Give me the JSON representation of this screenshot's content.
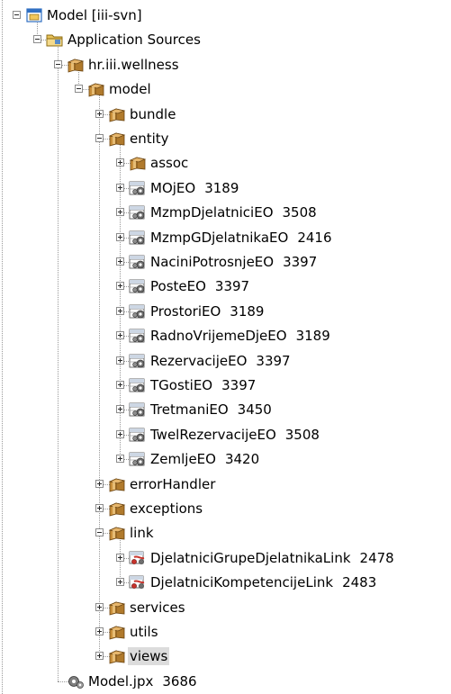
{
  "tree": {
    "items": [
      {
        "label": "Model [iii-svn]",
        "icon": "project-icon",
        "expanded": true,
        "depth": 0
      },
      {
        "label": "Application Sources",
        "icon": "folder-icon",
        "expanded": true,
        "depth": 1
      },
      {
        "label": "hr.iii.wellness",
        "icon": "package-icon",
        "expanded": true,
        "depth": 2
      },
      {
        "label": "model",
        "icon": "package-icon",
        "expanded": true,
        "depth": 3
      },
      {
        "label": "bundle",
        "icon": "package-icon",
        "expanded": false,
        "depth": 4
      },
      {
        "label": "entity",
        "icon": "package-icon",
        "expanded": true,
        "depth": 4
      },
      {
        "label": "assoc",
        "icon": "package-icon",
        "expanded": false,
        "depth": 5
      },
      {
        "label": "MOjEO",
        "version": "3189",
        "icon": "entity-object-icon",
        "expanded": false,
        "depth": 5
      },
      {
        "label": "MzmpDjelatniciEO",
        "version": "3508",
        "icon": "entity-object-icon",
        "expanded": false,
        "depth": 5
      },
      {
        "label": "MzmpGDjelatnikaEO",
        "version": "2416",
        "icon": "entity-object-icon",
        "expanded": false,
        "depth": 5
      },
      {
        "label": "NaciniPotrosnjeEO",
        "version": "3397",
        "icon": "entity-object-icon",
        "expanded": false,
        "depth": 5
      },
      {
        "label": "PosteEO",
        "version": "3397",
        "icon": "entity-object-icon",
        "expanded": false,
        "depth": 5
      },
      {
        "label": "ProstoriEO",
        "version": "3189",
        "icon": "entity-object-icon",
        "expanded": false,
        "depth": 5
      },
      {
        "label": "RadnoVrijemeDjeEO",
        "version": "3189",
        "icon": "entity-object-icon",
        "expanded": false,
        "depth": 5
      },
      {
        "label": "RezervacijeEO",
        "version": "3397",
        "icon": "entity-object-icon",
        "expanded": false,
        "depth": 5
      },
      {
        "label": "TGostiEO",
        "version": "3397",
        "icon": "entity-object-icon",
        "expanded": false,
        "depth": 5
      },
      {
        "label": "TretmaniEO",
        "version": "3450",
        "icon": "entity-object-icon",
        "expanded": false,
        "depth": 5
      },
      {
        "label": "TwelRezervacijeEO",
        "version": "3508",
        "icon": "entity-object-icon",
        "expanded": false,
        "depth": 5
      },
      {
        "label": "ZemljeEO",
        "version": "3420",
        "icon": "entity-object-icon",
        "expanded": false,
        "depth": 5
      },
      {
        "label": "errorHandler",
        "icon": "package-icon",
        "expanded": false,
        "depth": 4
      },
      {
        "label": "exceptions",
        "icon": "package-icon",
        "expanded": false,
        "depth": 4
      },
      {
        "label": "link",
        "icon": "package-icon",
        "expanded": true,
        "depth": 4
      },
      {
        "label": "DjelatniciGrupeDjelatnikaLink",
        "version": "2478",
        "icon": "association-link-icon",
        "expanded": false,
        "depth": 5
      },
      {
        "label": "DjelatniciKompetencijeLink",
        "version": "2483",
        "icon": "association-link-icon",
        "expanded": false,
        "depth": 5
      },
      {
        "label": "services",
        "icon": "package-icon",
        "expanded": false,
        "depth": 4
      },
      {
        "label": "utils",
        "icon": "package-icon",
        "expanded": false,
        "depth": 4
      },
      {
        "label": "views",
        "icon": "package-icon",
        "expanded": false,
        "depth": 4,
        "selected": true
      },
      {
        "label": "Model.jpx",
        "version": "3686",
        "icon": "project-file-icon",
        "leaf": true,
        "depth": 2
      }
    ]
  },
  "colors": {
    "package_brown": "#b07a2c",
    "folder_yellow": "#e8c25a",
    "project_blue": "#2f6fc2",
    "gear_gray": "#6f6f6f",
    "link_red": "#c8322b",
    "selection": "#dcdcdc",
    "tree_line": "#9a9a9a"
  }
}
